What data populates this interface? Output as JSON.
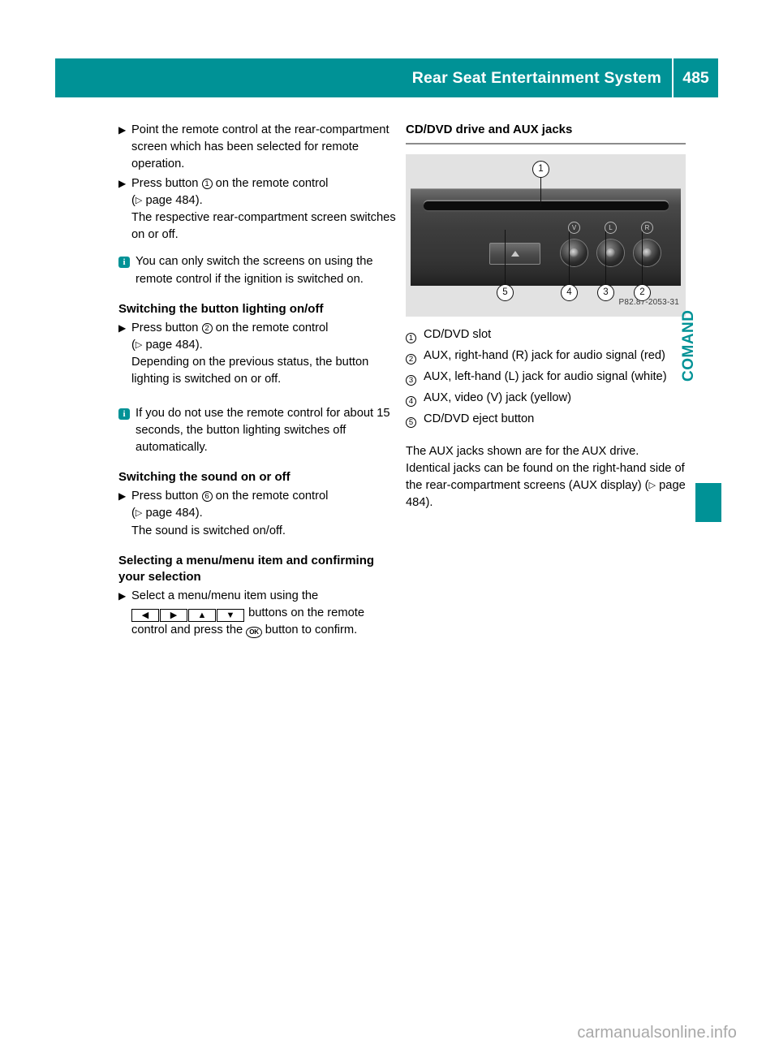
{
  "header": {
    "title": "Rear Seat Entertainment System",
    "page_number": "485",
    "band_color": "#009296"
  },
  "side_tab": {
    "label": "COMAND",
    "color": "#009296"
  },
  "watermark": "carmanualsonline.info",
  "left_column": {
    "step_1": {
      "marker": "▶",
      "text": "Point the remote control at the rear-compartment screen which has been selected for remote operation."
    },
    "step_2": {
      "marker": "▶",
      "text_before": "Press button",
      "button": "1",
      "text_after": "on the remote control",
      "ref_arrow": "▷",
      "ref_text": "page 484",
      "result": "The respective rear-compartment screen switches on or off."
    },
    "note_1": {
      "icon": "i",
      "text": "You can only switch the screens on using the remote control if the ignition is switched on."
    },
    "heading_1": "Switching the button lighting on/off",
    "step_3": {
      "marker": "▶",
      "text_before": "Press button",
      "button": "2",
      "text_after": "on the remote control",
      "ref_arrow": "▷",
      "ref_text": "page 484",
      "result": "Depending on the previous status, the button lighting is switched on or off."
    },
    "note_2": {
      "icon": "i",
      "text": "If you do not use the remote control for about 15 seconds, the button lighting switches off automatically."
    },
    "heading_2": "Switching the sound on or off",
    "step_4": {
      "marker": "▶",
      "text_before": "Press button",
      "button": "6",
      "text_after": "on the remote control",
      "ref_arrow": "▷",
      "ref_text": "page 484",
      "result": "The sound is switched on/off."
    },
    "heading_3": "Selecting a menu/menu item and confirming your selection",
    "step_5": {
      "marker": "▶",
      "text_before": "Select a menu/menu item using the",
      "buttons": [
        "◀",
        "▶",
        "▲",
        "▼"
      ],
      "text_middle": "buttons on the remote control and press the",
      "ok_label": "OK",
      "text_after": "button to confirm."
    }
  },
  "right_column": {
    "heading": "CD/DVD drive and AUX jacks",
    "figure": {
      "caption_code": "P82.87-2053-31",
      "callouts": [
        "1",
        "2",
        "3",
        "4",
        "5"
      ],
      "jack_labels": [
        "V",
        "L",
        "R"
      ]
    },
    "legend": [
      {
        "num": "1",
        "text": "CD/DVD slot"
      },
      {
        "num": "2",
        "text": "AUX, right-hand (R) jack for audio signal (red)"
      },
      {
        "num": "3",
        "text": "AUX, left-hand (L) jack for audio signal (white)"
      },
      {
        "num": "4",
        "text": "AUX, video (V) jack (yellow)"
      },
      {
        "num": "5",
        "text": "CD/DVD eject button"
      }
    ],
    "body": {
      "text_before": "The AUX jacks shown are for the AUX drive. Identical jacks can be found on the right-hand side of the rear-compartment screens (AUX display) (",
      "ref_arrow": "▷",
      "ref_text": "page 484",
      "text_after": ")."
    }
  }
}
